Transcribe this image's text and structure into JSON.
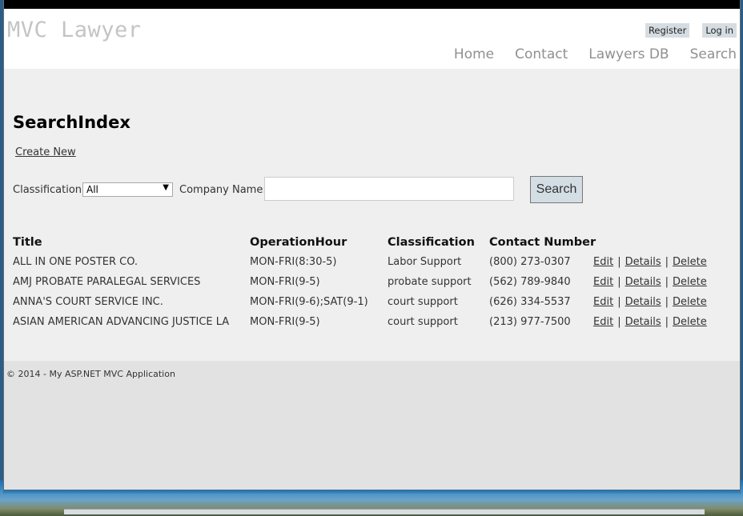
{
  "site": {
    "logo": "MVC Lawyer",
    "account_links": [
      "Register",
      "Log in"
    ],
    "nav": [
      "Home",
      "Contact",
      "Lawyers DB",
      "Search"
    ]
  },
  "page": {
    "title": "SearchIndex",
    "create_new": "Create New"
  },
  "search": {
    "classification_label": "Classification:",
    "classification_value": "All",
    "company_label": "Company Name:",
    "company_value": "",
    "button_label": "Search"
  },
  "table": {
    "headers": [
      "Title",
      "OperationHour",
      "Classification",
      "Contact Number"
    ],
    "rows": [
      {
        "title": "ALL IN ONE POSTER CO.",
        "hours": "MON-FRI(8:30-5)",
        "classification": "Labor Support",
        "phone": "(800) 273-0307"
      },
      {
        "title": "AMJ PROBATE PARALEGAL SERVICES",
        "hours": "MON-FRI(9-5)",
        "classification": "probate support",
        "phone": "(562) 789-9840"
      },
      {
        "title": "ANNA'S COURT SERVICE INC.",
        "hours": "MON-FRI(9-6);SAT(9-1)",
        "classification": "court support",
        "phone": "(626) 334-5537"
      },
      {
        "title": "ASIAN AMERICAN ADVANCING JUSTICE LA",
        "hours": "MON-FRI(9-5)",
        "classification": "court support",
        "phone": "(213) 977-7500"
      }
    ],
    "actions": {
      "edit": "Edit",
      "details": "Details",
      "delete": "Delete",
      "separator": "|"
    }
  },
  "footer": {
    "text": "© 2014 - My ASP.NET MVC Application"
  }
}
